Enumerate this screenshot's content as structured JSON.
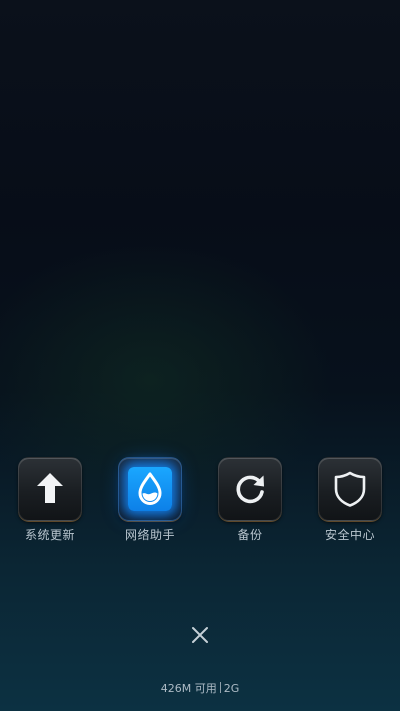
{
  "apps": [
    {
      "label": "系统更新",
      "icon": "arrow-up-icon",
      "active": false
    },
    {
      "label": "网络助手",
      "icon": "water-drop-icon",
      "active": true
    },
    {
      "label": "备份",
      "icon": "refresh-icon",
      "active": false
    },
    {
      "label": "安全中心",
      "icon": "shield-icon",
      "active": false
    }
  ],
  "close_icon": "close-icon",
  "status": {
    "memory": "426M 可用",
    "network": "2G"
  },
  "colors": {
    "accent": "#1a9cff",
    "label": "#b9c6cf"
  }
}
